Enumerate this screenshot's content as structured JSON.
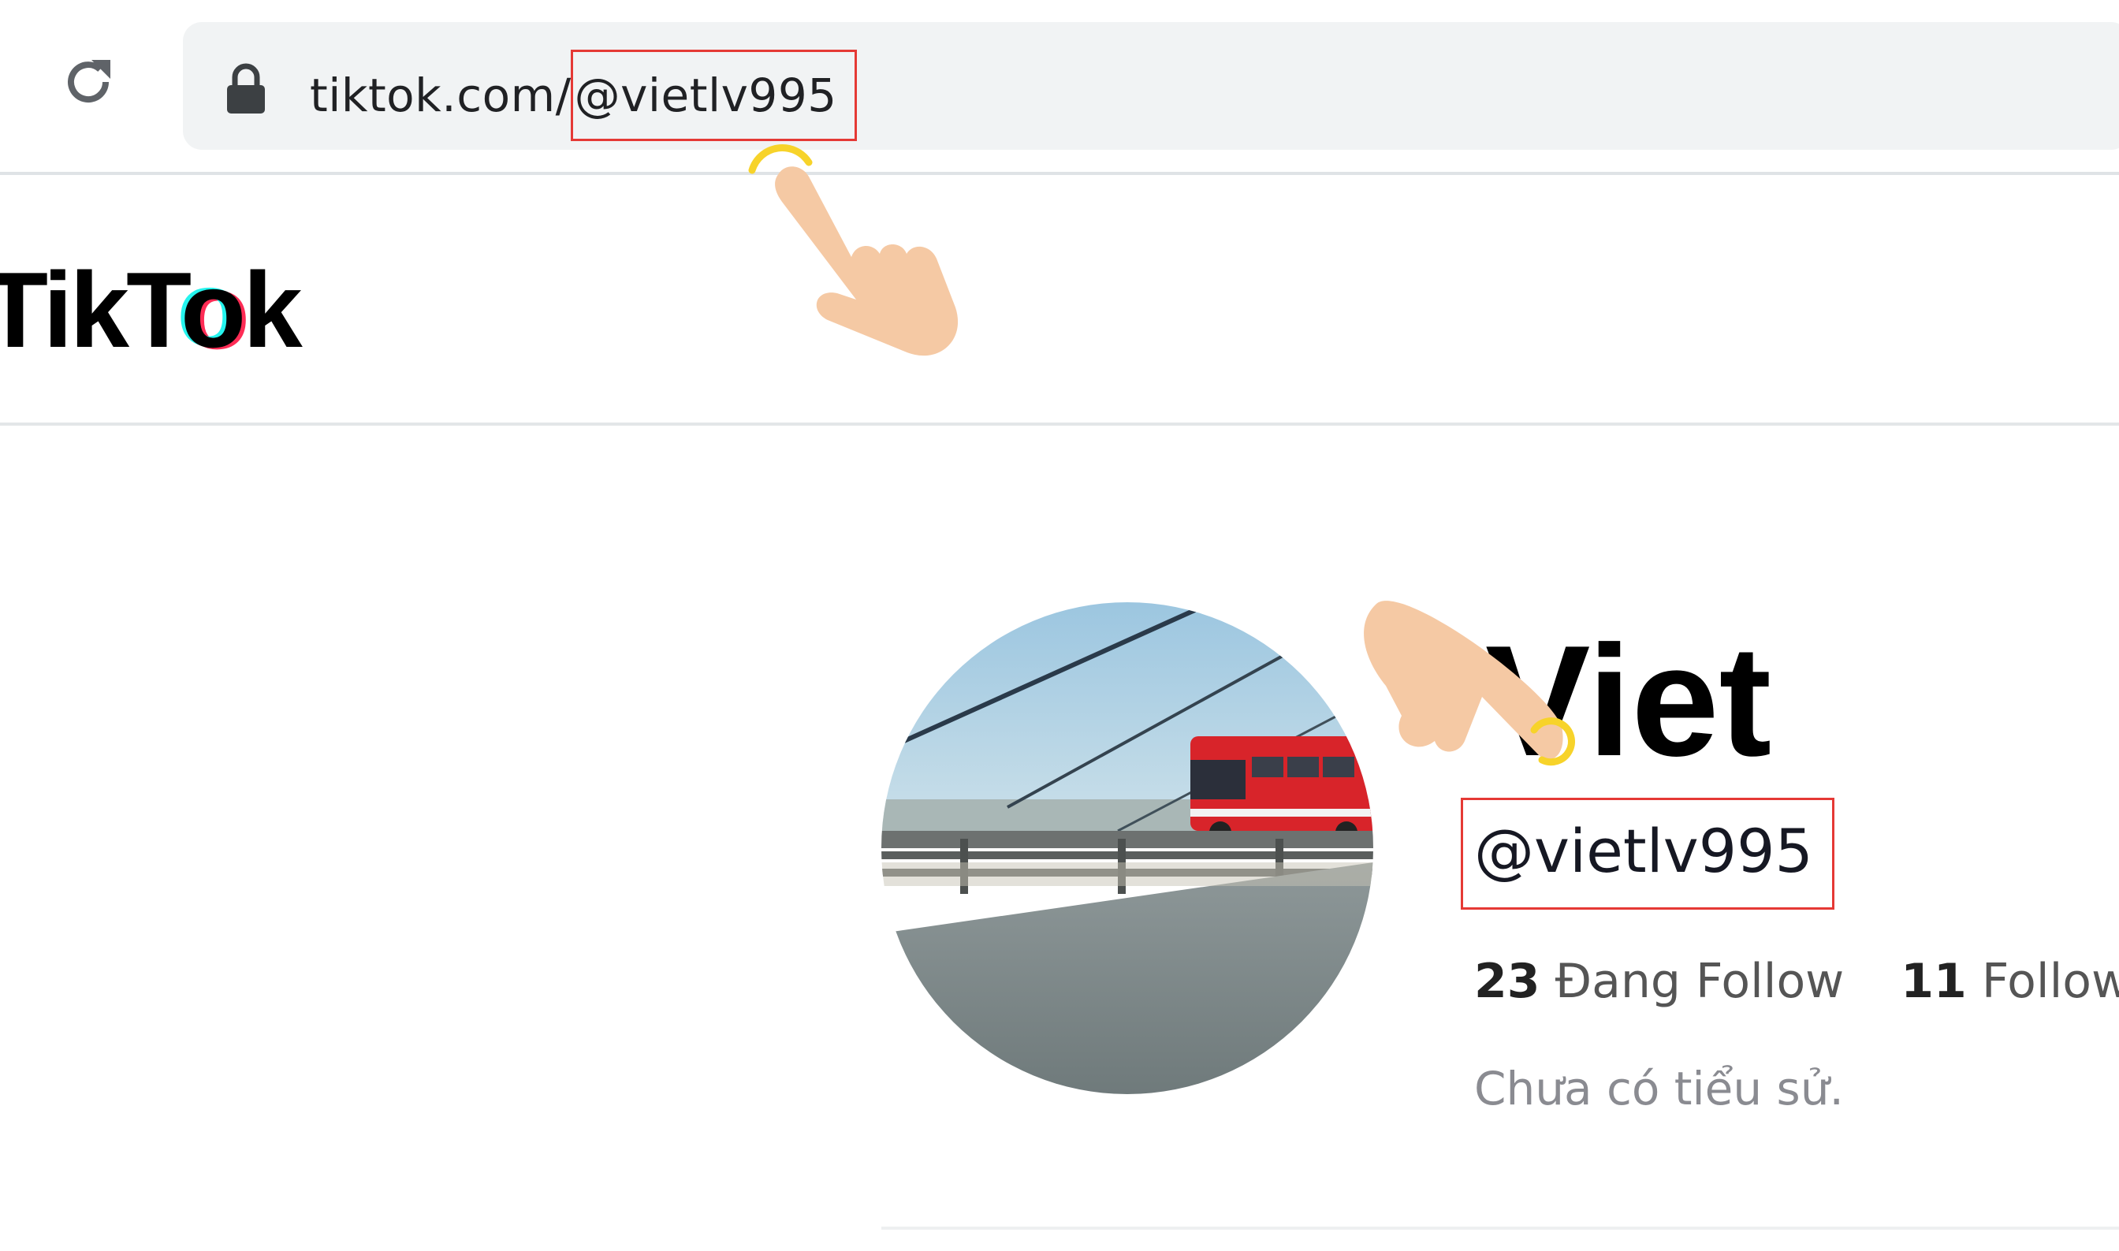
{
  "browser": {
    "url_prefix": "tiktok.com/",
    "url_handle": "@vietlv995",
    "reload_icon": "reload-icon",
    "lock_icon": "lock-icon"
  },
  "header": {
    "logo": {
      "part1": "TikT",
      "part2": "o",
      "part3": "k"
    }
  },
  "profile": {
    "display_name": "Viet",
    "username": "@vietlv995",
    "following_count": "23",
    "following_label": "Đang Follow",
    "followers_count": "11",
    "followers_label": "Follow",
    "bio": "Chưa có tiểu sử."
  },
  "colors": {
    "highlight_box": "#e53935",
    "tap_ring": "#f7d32a",
    "hand": "#f5c9a4",
    "tiktok_cyan": "#25f4ee",
    "tiktok_red": "#fe2c55"
  }
}
